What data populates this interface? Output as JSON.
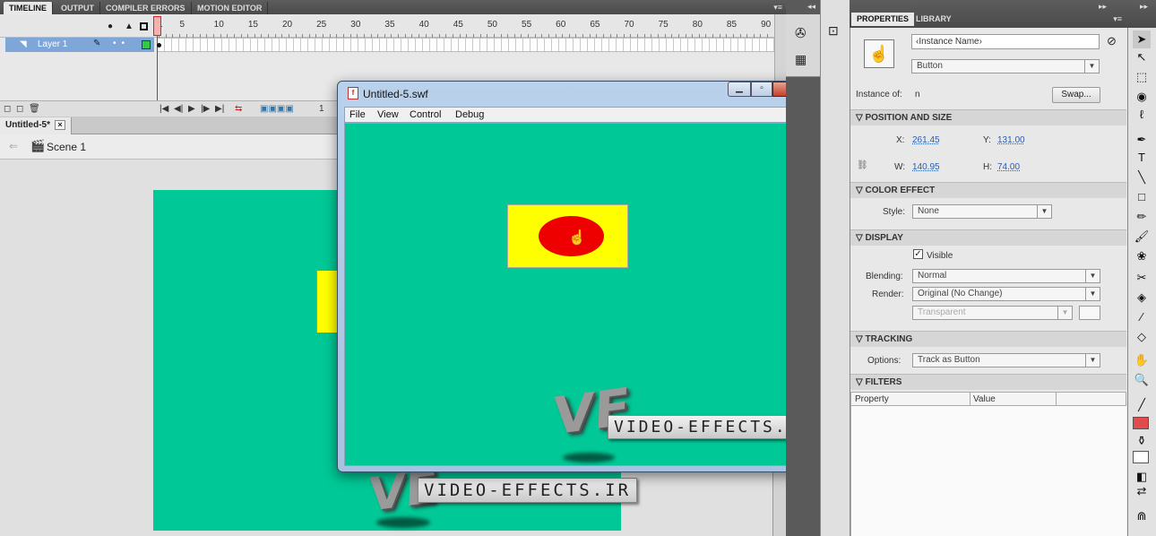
{
  "timeline": {
    "tabs": [
      "TIMELINE",
      "OUTPUT",
      "COMPILER ERRORS",
      "MOTION EDITOR"
    ],
    "frame_numbers": [
      "1",
      "5",
      "10",
      "15",
      "20",
      "25",
      "30",
      "35",
      "40",
      "45",
      "50",
      "55",
      "60",
      "65",
      "70",
      "75",
      "80",
      "85",
      "90"
    ],
    "layer_name": "Layer 1",
    "current_frame": 1,
    "bottom_readout": "1"
  },
  "document": {
    "tab_label": "Untitled-5*",
    "tab_close": "×",
    "scene_label": "Scene 1"
  },
  "swf_window": {
    "title": "Untitled-5.swf",
    "menu": [
      "File",
      "View",
      "Control",
      "Debug"
    ],
    "close_glyph": "x"
  },
  "watermark": {
    "logo": "VE",
    "text": "VIDEO-EFFECTS.IR"
  },
  "properties": {
    "tabs": [
      "PROPERTIES",
      "LIBRARY"
    ],
    "instance_name_placeholder": "‹Instance Name›",
    "symbol_type": "Button",
    "instance_of_label": "Instance of:",
    "instance_of_value": "n",
    "swap_label": "Swap...",
    "sections": {
      "position_size": "POSITION AND SIZE",
      "color_effect": "COLOR EFFECT",
      "display": "DISPLAY",
      "tracking": "TRACKING",
      "filters": "FILTERS"
    },
    "x_label": "X:",
    "x_value": "261.45",
    "y_label": "Y:",
    "y_value": "131.00",
    "w_label": "W:",
    "w_value": "140.95",
    "h_label": "H:",
    "h_value": "74.00",
    "style_label": "Style:",
    "style_value": "None",
    "visible_label": "Visible",
    "blending_label": "Blending:",
    "blending_value": "Normal",
    "render_label": "Render:",
    "render_value": "Original (No Change)",
    "render_bg_value": "Transparent",
    "options_label": "Options:",
    "options_value": "Track as Button",
    "filters_col_property": "Property",
    "filters_col_value": "Value"
  },
  "colors": {
    "stage_bg": "#00c896",
    "button_rect": "#ffff00",
    "button_ellipse": "#ee0000",
    "stroke_color": "#e24b4b",
    "fill_color": "#ffffff"
  }
}
